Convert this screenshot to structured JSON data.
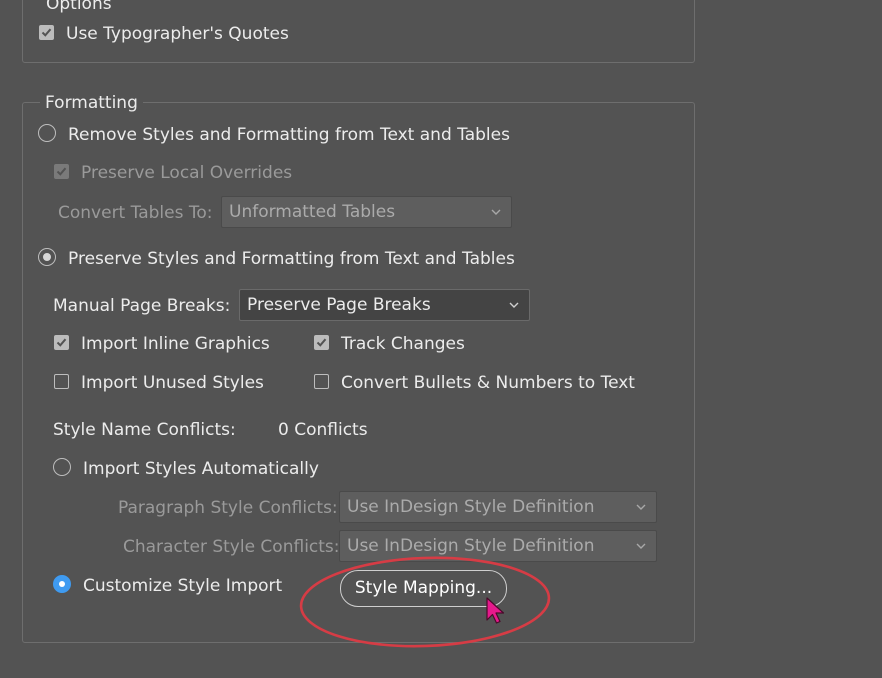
{
  "options": {
    "legend": "Options",
    "typographers_quotes": {
      "label": "Use Typographer's Quotes",
      "checked": true
    }
  },
  "formatting": {
    "legend": "Formatting",
    "remove_styles": {
      "label": "Remove Styles and Formatting from Text and Tables",
      "selected": false
    },
    "preserve_local_overrides": {
      "label": "Preserve Local Overrides",
      "checked": true,
      "enabled": false
    },
    "convert_tables": {
      "label": "Convert Tables To:",
      "value": "Unformatted Tables",
      "enabled": false
    },
    "preserve_styles": {
      "label": "Preserve Styles and Formatting from Text and Tables",
      "selected": true
    },
    "manual_page_breaks": {
      "label": "Manual Page Breaks:",
      "value": "Preserve Page Breaks"
    },
    "import_inline_graphics": {
      "label": "Import Inline Graphics",
      "checked": true
    },
    "track_changes": {
      "label": "Track Changes",
      "checked": true
    },
    "import_unused_styles": {
      "label": "Import Unused Styles",
      "checked": false
    },
    "convert_bullets": {
      "label": "Convert Bullets & Numbers to Text",
      "checked": false
    },
    "style_name_conflicts": {
      "label": "Style Name Conflicts:",
      "value": "0 Conflicts"
    },
    "import_styles_auto": {
      "label": "Import Styles Automatically",
      "selected": false
    },
    "paragraph_style_conflicts": {
      "label": "Paragraph Style Conflicts:",
      "value": "Use InDesign Style Definition",
      "enabled": false
    },
    "character_style_conflicts": {
      "label": "Character Style Conflicts:",
      "value": "Use InDesign Style Definition",
      "enabled": false
    },
    "customize_style_import": {
      "label": "Customize Style Import",
      "selected": true
    },
    "style_mapping_button": {
      "label": "Style Mapping..."
    }
  },
  "colors": {
    "accent": "#3f9bf1",
    "annotation": "#d63c45",
    "cursor": "#e6198c"
  }
}
